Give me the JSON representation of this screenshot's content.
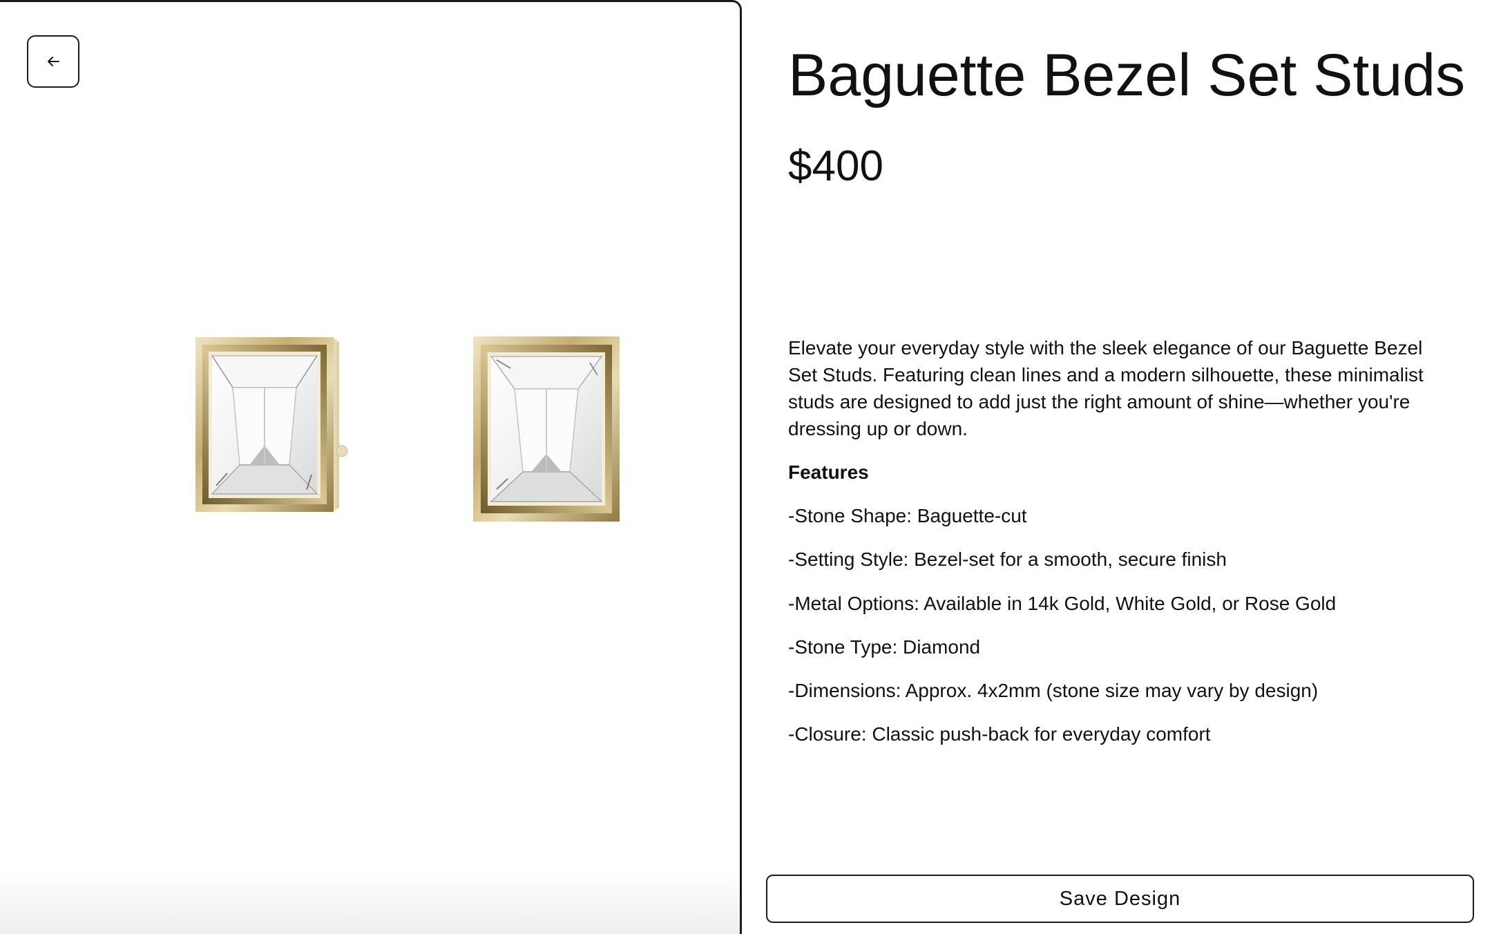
{
  "viewer": {
    "back_icon": "arrow-left-icon"
  },
  "product": {
    "title": "Baguette Bezel Set Studs",
    "price": "$400",
    "description": "Elevate your everyday style with the sleek elegance of our Baguette Bezel Set Studs. Featuring clean lines and a modern silhouette, these minimalist studs are designed to add just the right amount of shine—whether you're dressing up or down.",
    "features_heading": "Features",
    "features": [
      "-Stone Shape: Baguette-cut",
      "-Setting Style: Bezel-set for a smooth, secure finish",
      "-Metal Options: Available in 14k Gold, White Gold, or Rose Gold",
      "-Stone Type: Diamond",
      "-Dimensions: Approx. 4x2mm (stone size may vary by design)",
      "-Closure: Classic push-back for everyday comfort"
    ]
  },
  "actions": {
    "save_label": "Save Design"
  },
  "colors": {
    "gold": "#c9b27a",
    "border": "#1a1a1a",
    "text": "#111111"
  }
}
